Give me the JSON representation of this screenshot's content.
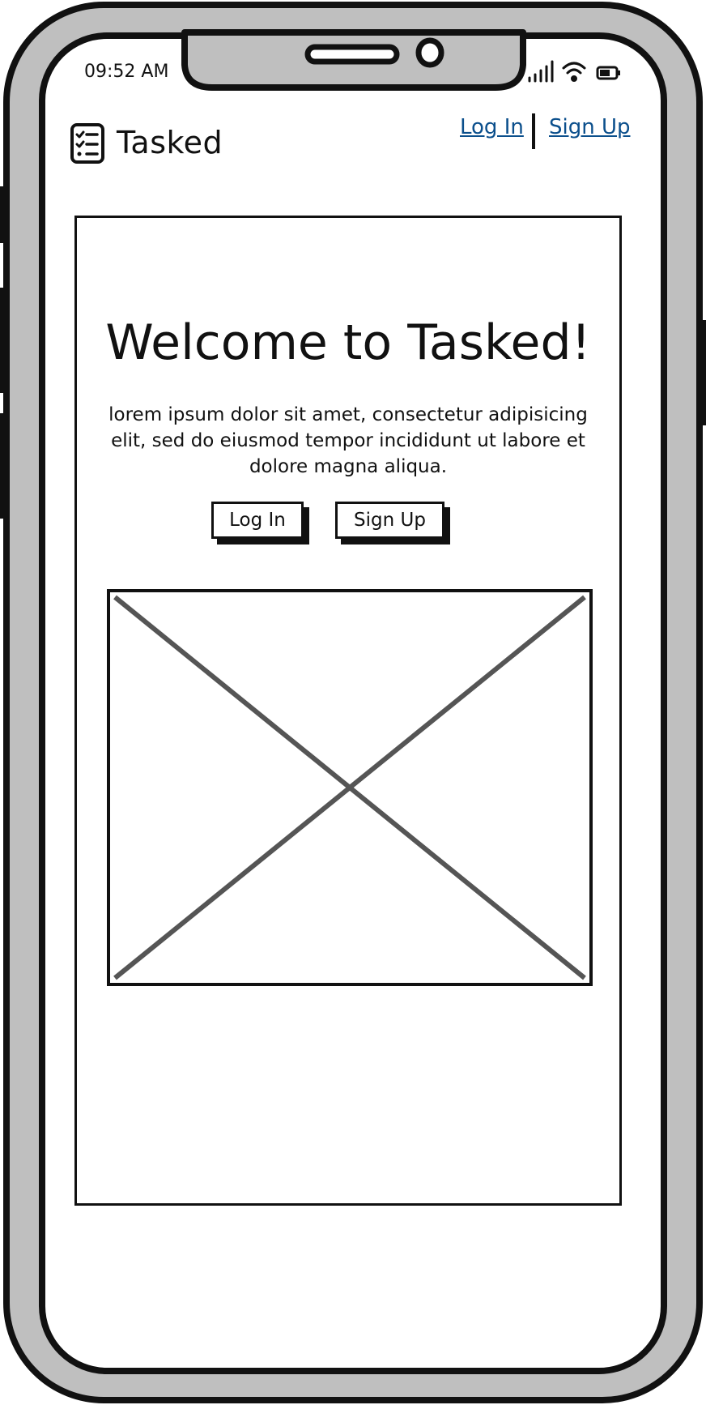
{
  "status_bar": {
    "time": "09:52 AM",
    "icons": [
      "signal-icon",
      "wifi-icon",
      "battery-icon"
    ]
  },
  "header": {
    "brand_icon": "checklist-icon",
    "brand": "Tasked",
    "links": [
      {
        "label": "Log In"
      },
      {
        "label": "Sign Up"
      }
    ]
  },
  "hero": {
    "title": "Welcome to Tasked!",
    "body": "lorem ipsum dolor sit amet, consectetur adipisicing elit, sed do eiusmod tempor incididunt ut labore et dolore magna aliqua.",
    "buttons": [
      {
        "label": "Log In"
      },
      {
        "label": "Sign Up"
      }
    ],
    "image": "image-placeholder"
  },
  "colors": {
    "ink": "#111111",
    "link": "#0b4f8c",
    "frame": "#bfbfbf",
    "placeholder_cross": "#555555"
  }
}
